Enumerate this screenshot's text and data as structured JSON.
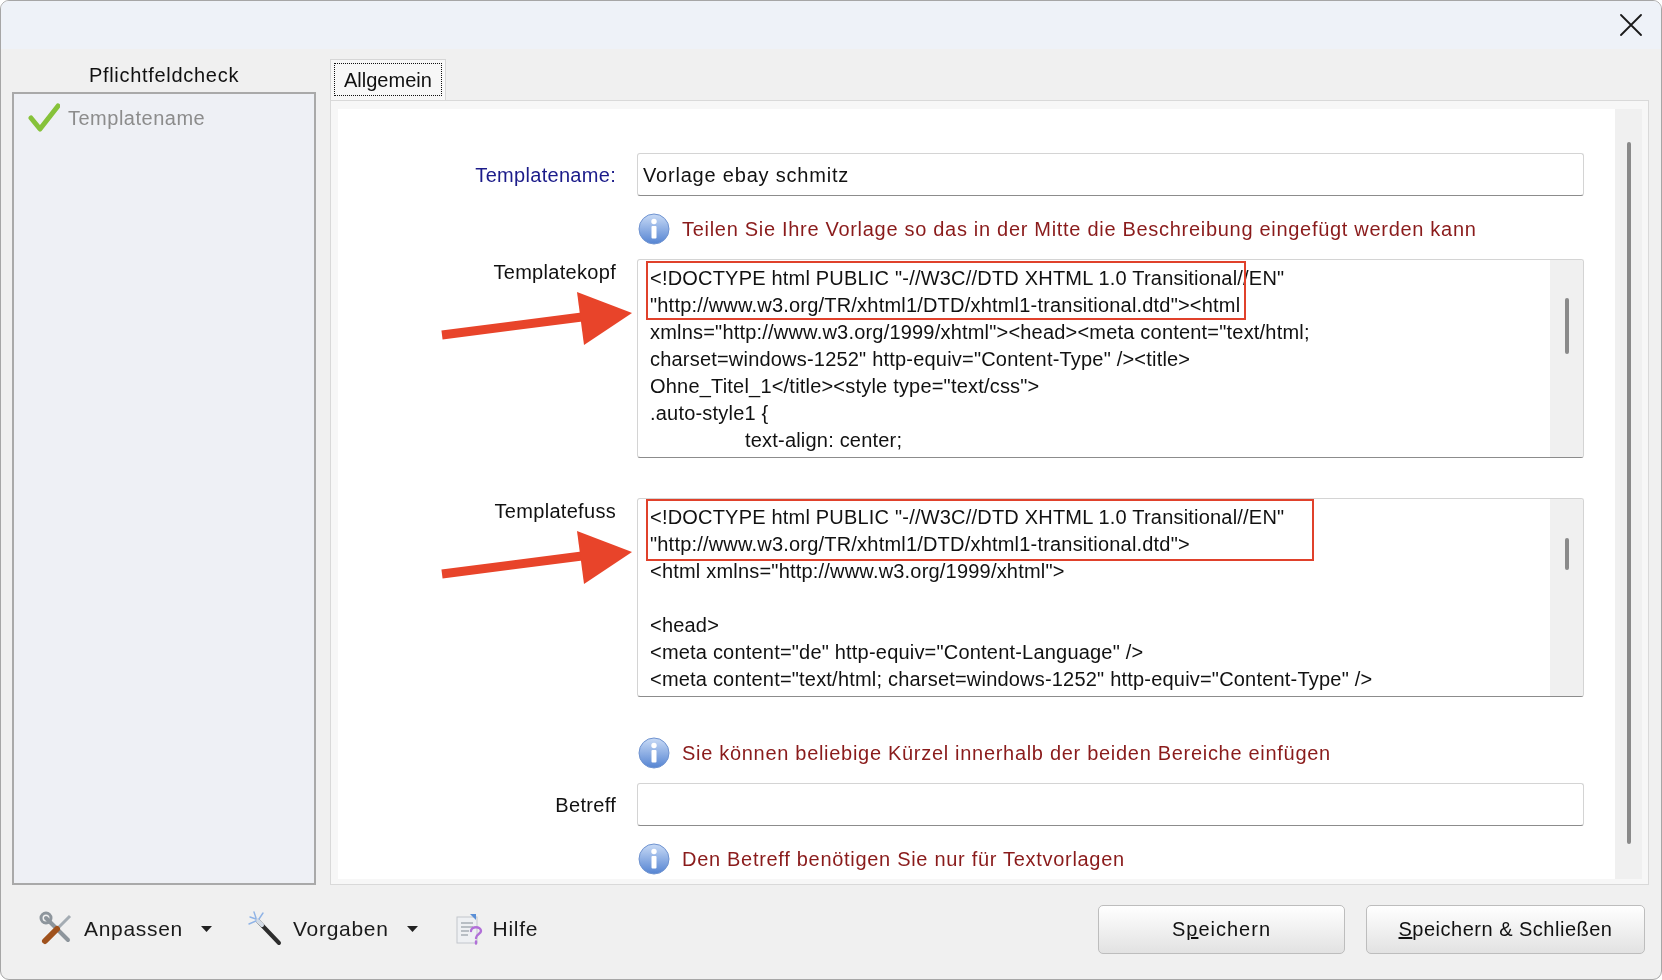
{
  "sidebar": {
    "title": "Pflichtfeldcheck",
    "items": [
      {
        "label": "Templatename",
        "checked": true
      }
    ]
  },
  "tabs": [
    {
      "label": "Allgemein",
      "selected": true
    }
  ],
  "form": {
    "rows": [
      {
        "kind": "text",
        "label": "Templatename:",
        "required": true,
        "value": "Vorlage ebay schmitz"
      },
      {
        "kind": "info",
        "text": "Teilen Sie Ihre Vorlage so das in der Mitte die Beschreibung eingefügt werden kann"
      },
      {
        "kind": "code",
        "label": "Templatekopf",
        "annotated": true,
        "value": "<!DOCTYPE html PUBLIC \"-//W3C//DTD XHTML 1.0 Transitional//EN\"\n\"http://www.w3.org/TR/xhtml1/DTD/xhtml1-transitional.dtd\"><html\nxmlns=\"http://www.w3.org/1999/xhtml\"><head><meta content=\"text/html;\ncharset=windows-1252\" http-equiv=\"Content-Type\" /><title>\nOhne_Titel_1</title><style type=\"text/css\">\n.auto-style1 {\n\ttext-align: center;"
      },
      {
        "kind": "code",
        "label": "Templatefuss",
        "annotated": true,
        "value": "<!DOCTYPE html PUBLIC \"-//W3C//DTD XHTML 1.0 Transitional//EN\"\n\"http://www.w3.org/TR/xhtml1/DTD/xhtml1-transitional.dtd\">\n<html xmlns=\"http://www.w3.org/1999/xhtml\">\n\n<head>\n<meta content=\"de\" http-equiv=\"Content-Language\" />\n<meta content=\"text/html; charset=windows-1252\" http-equiv=\"Content-Type\" />"
      },
      {
        "kind": "info",
        "text": "Sie können beliebige Kürzel innerhalb der beiden Bereiche einfügen"
      },
      {
        "kind": "text",
        "label": "Betreff",
        "required": false
      },
      {
        "kind": "info",
        "text": "Den Betreff benötigen Sie nur für Textvorlagen"
      }
    ]
  },
  "toolbar": {
    "items": [
      {
        "label": "Anpassen",
        "dropdown": true
      },
      {
        "label": "Vorgaben",
        "dropdown": true
      },
      {
        "label": "Hilfe",
        "dropdown": false
      }
    ]
  },
  "buttons": [
    {
      "before": "S",
      "mnemonic": "p",
      "after": "eichern"
    },
    {
      "mnemonic": "S",
      "after": "peichern & Schließen"
    }
  ]
}
